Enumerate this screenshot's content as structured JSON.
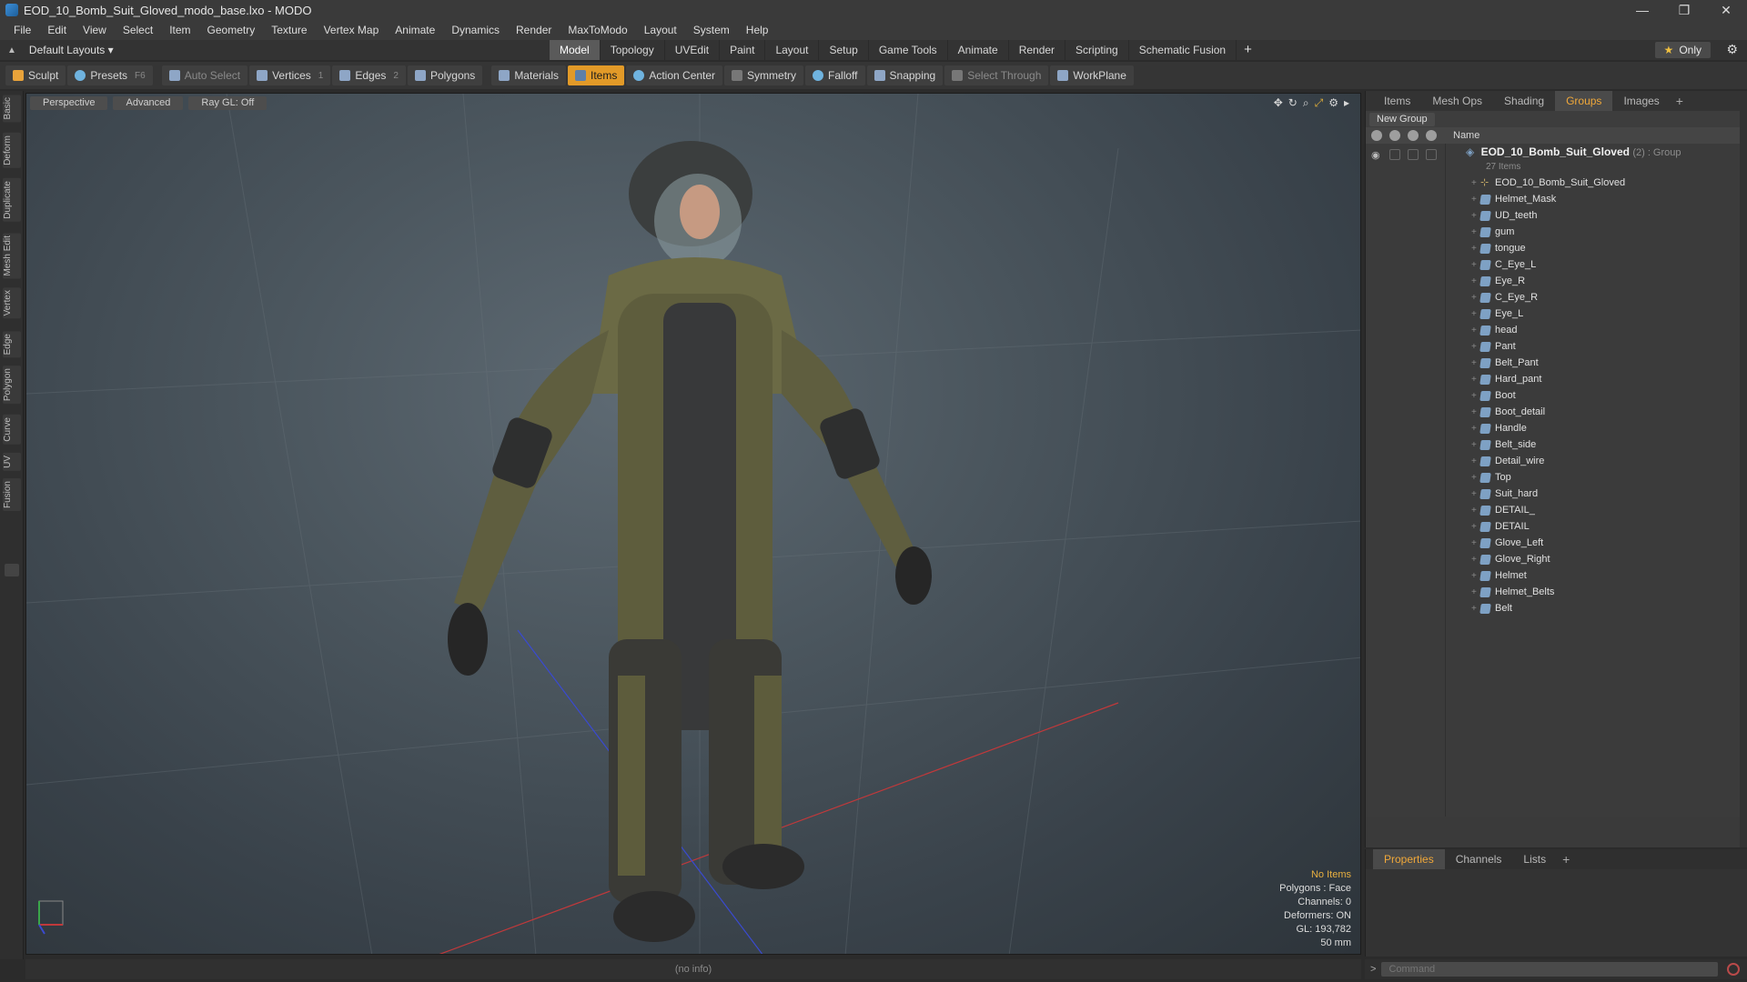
{
  "window": {
    "title": "EOD_10_Bomb_Suit_Gloved_modo_base.lxo - MODO",
    "minimize": "—",
    "restore": "❐",
    "close": "✕"
  },
  "menu": [
    "File",
    "Edit",
    "View",
    "Select",
    "Item",
    "Geometry",
    "Texture",
    "Vertex Map",
    "Animate",
    "Dynamics",
    "Render",
    "MaxToModo",
    "Layout",
    "System",
    "Help"
  ],
  "layout": {
    "current": "Default Layouts ▾",
    "tabs": [
      "Model",
      "Topology",
      "UVEdit",
      "Paint",
      "Layout",
      "Setup",
      "Game Tools",
      "Animate",
      "Render",
      "Scripting",
      "Schematic Fusion"
    ],
    "active_tab": "Model",
    "add": "+",
    "only_star": "★",
    "only_label": "Only",
    "gear": "⚙"
  },
  "toolbar": {
    "sculpt": "Sculpt",
    "presets": "Presets",
    "presets_key": "F6",
    "auto_select": "Auto Select",
    "vertices": "Vertices",
    "vertices_key": "1",
    "edges": "Edges",
    "edges_key": "2",
    "polygons": "Polygons",
    "materials": "Materials",
    "items": "Items",
    "action_center": "Action Center",
    "symmetry": "Symmetry",
    "falloff": "Falloff",
    "snapping": "Snapping",
    "select_through": "Select Through",
    "workplane": "WorkPlane"
  },
  "left_tabs": [
    "Basic",
    "Deform",
    "Duplicate",
    "Mesh Edit",
    "Vertex",
    "Edge",
    "Polygon",
    "Curve",
    "UV",
    "Fusion"
  ],
  "viewport": {
    "perspective": "Perspective",
    "advanced": "Advanced",
    "raygl": "Ray GL: Off",
    "info": {
      "items": "No Items",
      "polygons": "Polygons : Face",
      "channels": "Channels: 0",
      "deformers": "Deformers: ON",
      "gl": "GL: 193,782",
      "focal": "50 mm"
    }
  },
  "status": {
    "text": "(no info)"
  },
  "items_panel": {
    "tabs": [
      "Items",
      "Mesh Ops",
      "Shading",
      "Groups",
      "Images"
    ],
    "active_tab": "Groups",
    "new_group": "New Group",
    "name_col": "Name",
    "group": {
      "name": "EOD_10_Bomb_Suit_Gloved",
      "meta": "(2) : Group",
      "count": "27 Items"
    },
    "items": [
      "EOD_10_Bomb_Suit_Gloved",
      "Helmet_Mask",
      "UD_teeth",
      "gum",
      "tongue",
      "C_Eye_L",
      "Eye_R",
      "C_Eye_R",
      "Eye_L",
      "head",
      "Pant",
      "Belt_Pant",
      "Hard_pant",
      "Boot",
      "Boot_detail",
      "Handle",
      "Belt_side",
      "Detail_wire",
      "Top",
      "Suit_hard",
      "DETAIL_",
      "DETAIL",
      "Glove_Left",
      "Glove_Right",
      "Helmet",
      "Helmet_Belts",
      "Belt"
    ]
  },
  "properties_panel": {
    "tabs": [
      "Properties",
      "Channels",
      "Lists"
    ],
    "active_tab": "Properties"
  },
  "command": {
    "placeholder": "Command",
    "prompt": ">"
  }
}
